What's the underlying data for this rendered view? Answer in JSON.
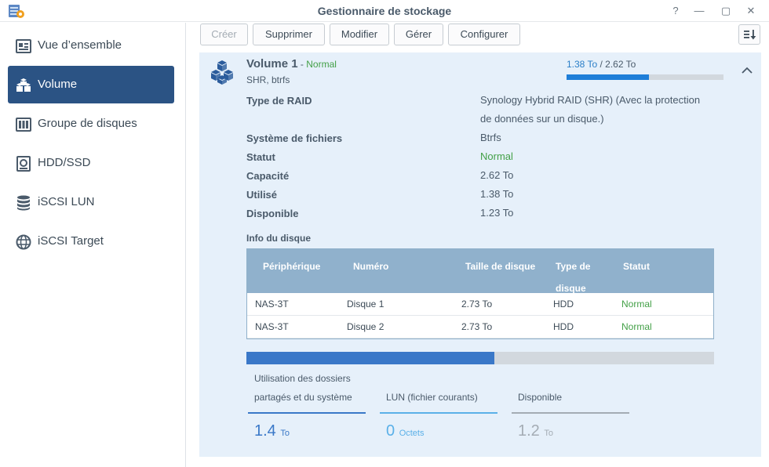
{
  "window": {
    "title": "Gestionnaire de stockage",
    "icon": "storage-manager-app-icon",
    "controls": {
      "help": "?",
      "minimize": "—",
      "maximize": "▢",
      "close": "✕"
    }
  },
  "sidebar": {
    "items": [
      {
        "label": "Vue d’ensemble",
        "icon": "overview-icon",
        "active": false
      },
      {
        "label": "Volume",
        "icon": "volume-cubes-icon",
        "active": true
      },
      {
        "label": "Groupe de disques",
        "icon": "disk-group-icon",
        "active": false
      },
      {
        "label": "HDD/SSD",
        "icon": "hdd-icon",
        "active": false
      },
      {
        "label": "iSCSI LUN",
        "icon": "database-icon",
        "active": false
      },
      {
        "label": "iSCSI Target",
        "icon": "globe-icon",
        "active": false
      }
    ]
  },
  "toolbar": {
    "create": "Créer",
    "delete": "Supprimer",
    "modify": "Modifier",
    "manage": "Gérer",
    "configure": "Configurer",
    "sort_icon": "sort-icon"
  },
  "volume": {
    "name": "Volume 1",
    "dash": " - ",
    "status": "Normal",
    "subtitle": "SHR, btrfs",
    "used": "1.38 To",
    "separator": " / ",
    "total": "2.62 To",
    "used_fraction": 0.527,
    "details": [
      {
        "label": "Type de RAID",
        "value": "Synology Hybrid RAID (SHR) (Avec la protection de données sur un disque.)"
      },
      {
        "label": "Système de fichiers",
        "value": "Btrfs"
      },
      {
        "label": "Statut",
        "value": "Normal"
      },
      {
        "label": "Capacité",
        "value": "2.62 To"
      },
      {
        "label": "Utilisé",
        "value": "1.38 To"
      },
      {
        "label": "Disponible",
        "value": "1.23 To"
      }
    ],
    "raid_value_line1": "Synology Hybrid RAID (SHR) (Avec la protection",
    "raid_value_line2": "de données sur un disque.)"
  },
  "disk_info": {
    "title": "Info du disque",
    "headers": {
      "device": "Périphérique",
      "number": "Numéro",
      "size": "Taille de disque",
      "type_l1": "Type de",
      "type_l2": "disque",
      "status": "Statut"
    },
    "rows": [
      {
        "device": "NAS-3T",
        "number": "Disque 1",
        "size": "2.73 To",
        "type": "HDD",
        "status": "Normal"
      },
      {
        "device": "NAS-3T",
        "number": "Disque 2",
        "size": "2.73 To",
        "type": "HDD",
        "status": "Normal"
      }
    ]
  },
  "allocation": {
    "used_fraction": 0.53,
    "colors": {
      "shared": "#3a78c8",
      "lun": "#5ab0e8",
      "available": "#a4acb4"
    },
    "shared": {
      "label_l1": "Utilisation des dossiers",
      "label_l2": "partagés et du système",
      "value": "1.4",
      "unit": "To"
    },
    "lun": {
      "label": "LUN (fichier courants)",
      "value": "0",
      "unit": "Octets"
    },
    "available": {
      "label": "Disponible",
      "value": "1.2",
      "unit": "To"
    }
  }
}
